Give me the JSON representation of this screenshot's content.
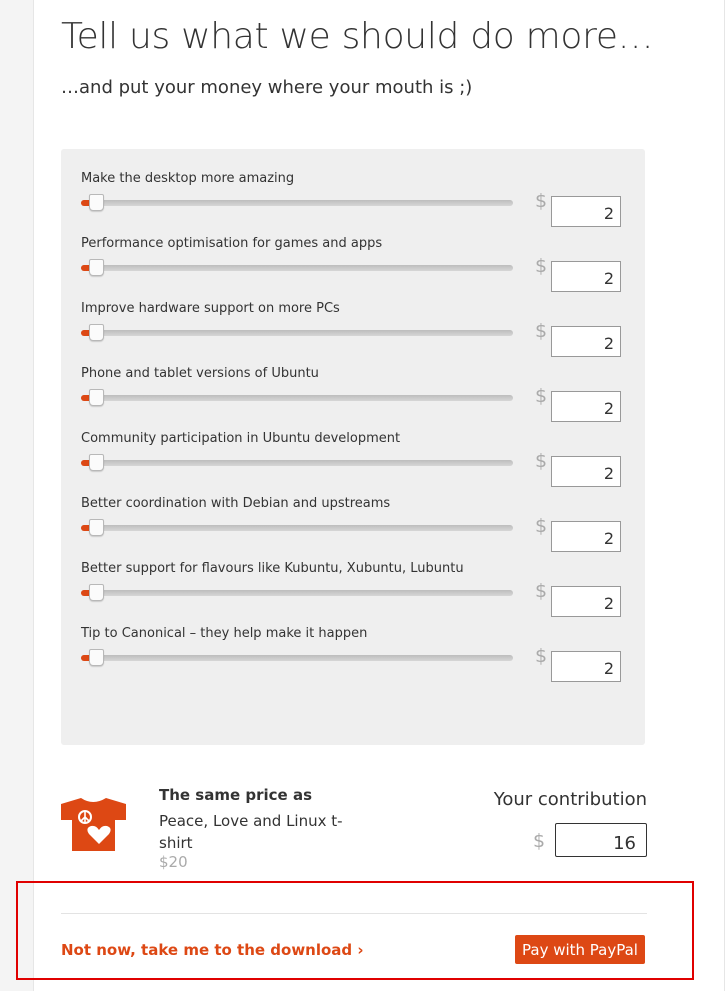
{
  "header": {
    "title": "Tell us what we should do more…",
    "subtitle": "…and put your money where your mouth is ;)"
  },
  "sliders": [
    {
      "label": "Make the desktop more amazing",
      "currency": "$",
      "value": "2",
      "level": 0.0
    },
    {
      "label": "Performance optimisation for games and apps",
      "currency": "$",
      "value": "2",
      "level": 0.0
    },
    {
      "label": "Improve hardware support on more PCs",
      "currency": "$",
      "value": "2",
      "level": 0.0
    },
    {
      "label": "Phone and tablet versions of Ubuntu",
      "currency": "$",
      "value": "2",
      "level": 0.0
    },
    {
      "label": "Community participation in Ubuntu development",
      "currency": "$",
      "value": "2",
      "level": 0.0
    },
    {
      "label": "Better coordination with Debian and upstreams",
      "currency": "$",
      "value": "2",
      "level": 0.0
    },
    {
      "label": "Better support for flavours like Kubuntu, Xubuntu, Lubuntu",
      "currency": "$",
      "value": "2",
      "level": 0.0
    },
    {
      "label": "Tip to Canonical – they help make it happen",
      "currency": "$",
      "value": "2",
      "level": 0.0
    }
  ],
  "summary": {
    "same_price_label": "The same price as",
    "item_name": "Peace, Love and Linux t-shirt",
    "item_price": "$20",
    "contribution_label": "Your contribution",
    "currency": "$",
    "contribution_value": "16",
    "tshirt_icon": "tshirt-icon"
  },
  "footer": {
    "download_link": "Not now, take me to the download ›",
    "paypal_button": "Pay with PayPal"
  },
  "colors": {
    "accent": "#dd4814",
    "highlight_box": "#e00000"
  }
}
